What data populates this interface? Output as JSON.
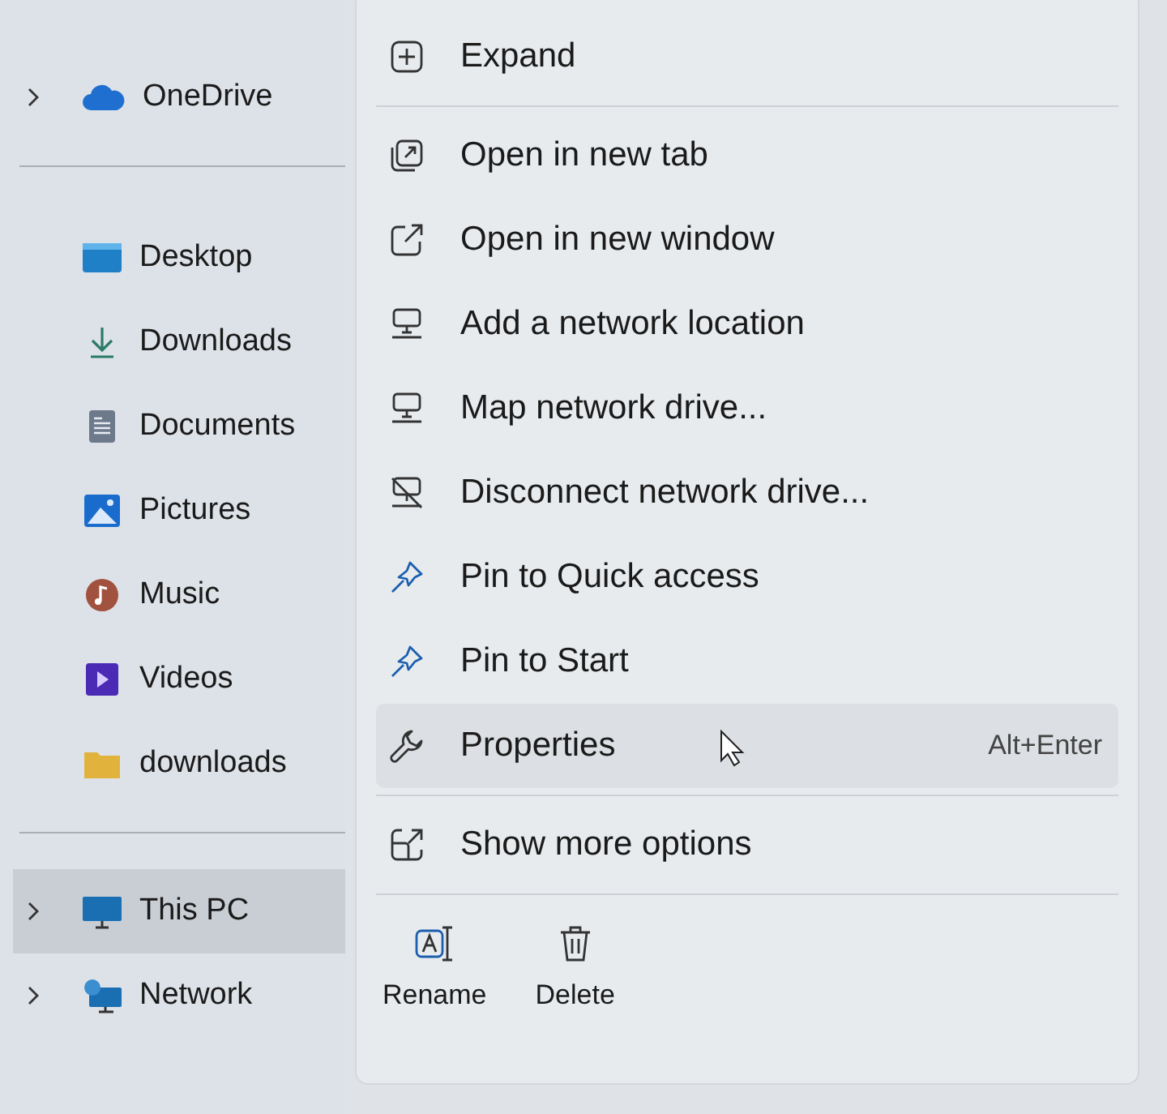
{
  "sidebar": {
    "sections": [
      {
        "items": [
          {
            "label": "OneDrive",
            "kind": "cloud",
            "expandable": true,
            "selected": false
          }
        ]
      },
      {
        "items": [
          {
            "label": "Desktop",
            "kind": "desktop",
            "expandable": false,
            "selected": false
          },
          {
            "label": "Downloads",
            "kind": "download",
            "expandable": false,
            "selected": false
          },
          {
            "label": "Documents",
            "kind": "document",
            "expandable": false,
            "selected": false
          },
          {
            "label": "Pictures",
            "kind": "picture",
            "expandable": false,
            "selected": false
          },
          {
            "label": "Music",
            "kind": "music",
            "expandable": false,
            "selected": false
          },
          {
            "label": "Videos",
            "kind": "video",
            "expandable": false,
            "selected": false
          },
          {
            "label": "downloads",
            "kind": "folder",
            "expandable": false,
            "selected": false
          }
        ]
      },
      {
        "items": [
          {
            "label": "This PC",
            "kind": "pc",
            "expandable": true,
            "selected": true
          },
          {
            "label": "Network",
            "kind": "network",
            "expandable": true,
            "selected": false
          }
        ]
      }
    ]
  },
  "context_menu": {
    "groups": [
      [
        {
          "label": "Expand",
          "kind": "expand",
          "selected": false
        }
      ],
      [
        {
          "label": "Open in new tab",
          "kind": "tab",
          "selected": false
        },
        {
          "label": "Open in new window",
          "kind": "window",
          "selected": false
        },
        {
          "label": "Add a network location",
          "kind": "addnet",
          "selected": false
        },
        {
          "label": "Map network drive...",
          "kind": "mapnet",
          "selected": false
        },
        {
          "label": "Disconnect network drive...",
          "kind": "disconnect",
          "selected": false
        },
        {
          "label": "Pin to Quick access",
          "kind": "pin",
          "selected": false
        },
        {
          "label": "Pin to Start",
          "kind": "pin",
          "selected": false
        },
        {
          "label": "Properties",
          "kind": "wrench",
          "selected": true,
          "shortcut": "Alt+Enter"
        }
      ],
      [
        {
          "label": "Show more options",
          "kind": "more",
          "selected": false
        }
      ]
    ],
    "actions": [
      {
        "label": "Rename",
        "kind": "rename"
      },
      {
        "label": "Delete",
        "kind": "delete"
      }
    ]
  }
}
